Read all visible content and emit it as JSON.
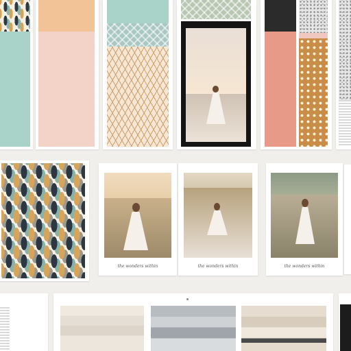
{
  "moodboard": {
    "photo_card_captions": [
      "the wonders within",
      "the wonders within",
      "the wonders within"
    ]
  },
  "palette": {
    "mint": "#a9d2c8",
    "peach": "#f3c398",
    "blush": "#f3d2c8",
    "coral": "#e79a87",
    "caramel": "#c88d46",
    "charcoal": "#2b2b2b",
    "sand": "#efe4d2"
  },
  "icons": {
    "photo_frame": "photo-icon",
    "pattern_tile": "pattern-icon"
  }
}
